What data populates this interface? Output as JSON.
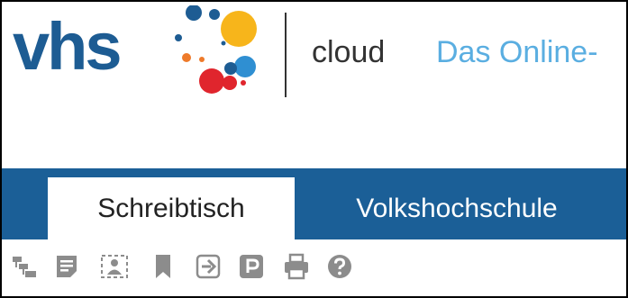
{
  "header": {
    "logo_text": "vhs",
    "product": "cloud",
    "tagline": "Das Online-"
  },
  "nav": {
    "tabs": [
      {
        "label": "Schreibtisch",
        "active": true
      },
      {
        "label": "Volkshochschule",
        "active": false
      }
    ]
  },
  "toolbar": {
    "icons": [
      "hierarchy-icon",
      "notes-icon",
      "participants-icon",
      "bookmark-icon",
      "logout-icon",
      "parking-icon",
      "print-icon",
      "help-icon"
    ]
  },
  "colors": {
    "brand_blue": "#1d5c93",
    "nav_blue": "#1b5f97",
    "tagline_blue": "#5aaee1",
    "logo_yellow": "#f7b51b",
    "logo_red": "#e0252d",
    "logo_orange": "#ee7a2a",
    "logo_lightblue": "#2f8fd2",
    "icon_grey": "#8c8c8c"
  }
}
